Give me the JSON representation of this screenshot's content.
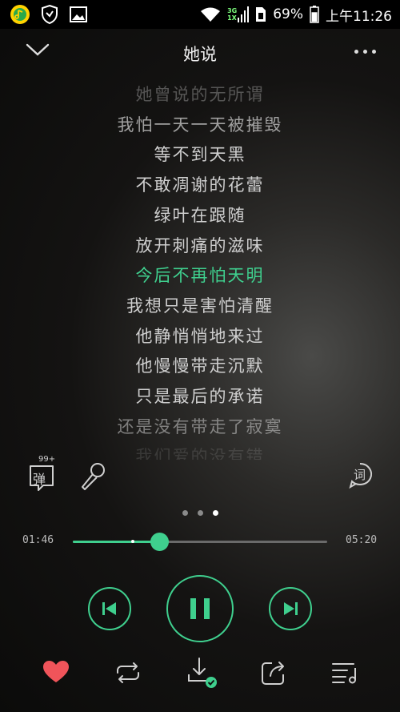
{
  "status_bar": {
    "network_top": "3G",
    "network_bottom": "1X",
    "battery": "69%",
    "time": "上午11:26"
  },
  "header": {
    "title": "她说"
  },
  "lyrics": {
    "lines": [
      "她曾说的无所谓",
      "我怕一天一天被摧毁",
      "等不到天黑",
      "不敢凋谢的花蕾",
      "绿叶在跟随",
      "放开刺痛的滋味",
      "今后不再怕天明",
      "我想只是害怕清醒",
      "他静悄悄地来过",
      "他慢慢带走沉默",
      "只是最后的承诺",
      "还是没有带走了寂寞",
      "我们爱的没有错"
    ],
    "active_index": 6
  },
  "tools": {
    "danmaku_badge": "99+",
    "danmaku_label": "弹",
    "lyric_label": "词"
  },
  "pager": {
    "count": 3,
    "active": 2
  },
  "progress": {
    "current": "01:46",
    "total": "05:20",
    "fraction": 0.34,
    "buffered": 0.23
  },
  "colors": {
    "accent": "#3fcf8e",
    "heart": "#f0545a"
  },
  "icons": {
    "collapse": "chevron-down-icon",
    "more": "more-dots-icon",
    "mic": "microphone-icon",
    "prev": "skip-previous-icon",
    "play_pause": "pause-icon",
    "next": "skip-next-icon",
    "like": "heart-icon",
    "repeat": "repeat-icon",
    "download": "download-icon",
    "share": "share-icon",
    "playlist": "playlist-icon"
  }
}
